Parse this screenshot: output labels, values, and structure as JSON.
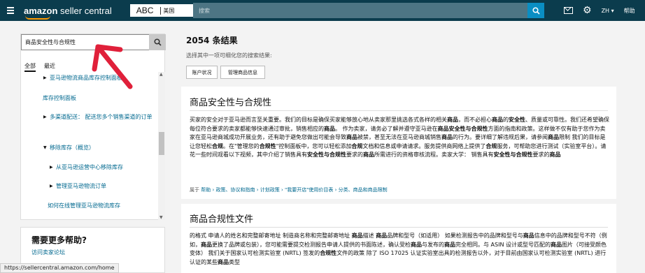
{
  "topnav": {
    "logo_brand": "amazon",
    "logo_product": " seller central",
    "store": "ABC",
    "marketplace": "美国",
    "search_placeholder": "搜索",
    "language": "ZH ▾",
    "help": "帮助"
  },
  "sidebar": {
    "search_value": "商品安全性与合规性",
    "tabs": [
      "全部",
      "最近"
    ],
    "tree": [
      {
        "label": "亚马逊物流商品库存控制面板",
        "arrow": "▶"
      },
      {
        "label": "库存控制面板",
        "arrow": ""
      },
      {
        "label": "多渠道配送： 配送您多个销售渠道的订单",
        "arrow": "▶"
      },
      {
        "label": "移除库存（概览）",
        "arrow": "▼"
      },
      {
        "label": "从亚马逊运营中心移除库存",
        "arrow": "▶"
      },
      {
        "label": "管理亚马逊物流订单",
        "arrow": "▶"
      },
      {
        "label": "如何在线管理亚马逊物流库存",
        "arrow": ""
      }
    ],
    "more_help_title": "需要更多帮助?",
    "more_help_link": "访问卖家论坛"
  },
  "results": {
    "count": "2054 条结果",
    "refine_hint": "选择其中一项可细化您的搜索结果:",
    "filters": [
      "账户状况",
      "管理商品信息"
    ],
    "items": [
      {
        "title": "商品安全性与合规性",
        "breadcrumb_prefix": "属于",
        "breadcrumb": "帮助 › 政策、协议和指南 › 计划政策 › \"我要开店\"使用价目表 › 分类、商品和商品限制"
      },
      {
        "title": "商品合规性文件"
      }
    ]
  },
  "statusbar": "https://sellercentral.amazon.com/home",
  "colors": {
    "nav_bg": "#0b3c4d",
    "search_bg": "#4d7584",
    "search_button": "#0a8ec3",
    "link": "#00688f",
    "accent": "#ff9900",
    "annotation": "#e0203a"
  },
  "icons": [
    "hamburger-icon",
    "search-icon",
    "mail-icon",
    "gear-icon",
    "arrow-annotation"
  ]
}
